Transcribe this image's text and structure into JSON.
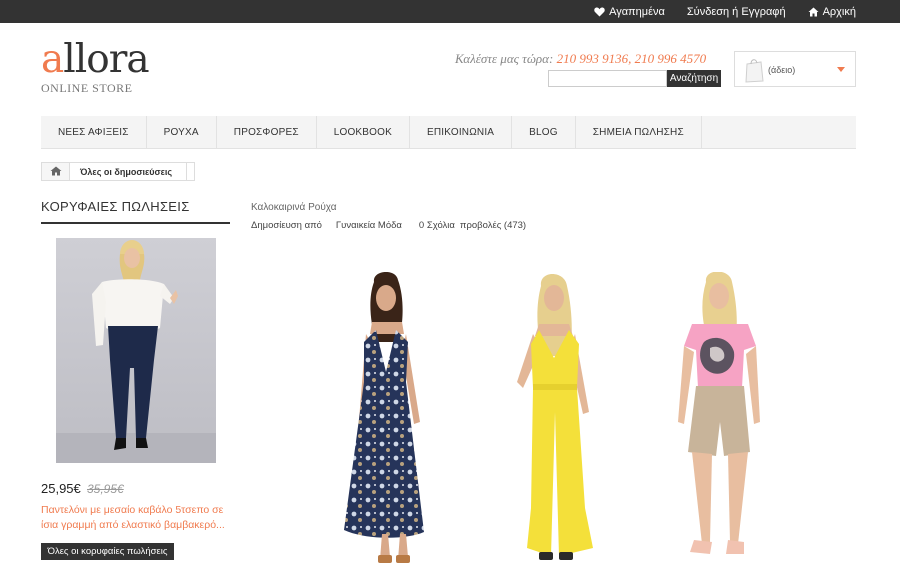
{
  "topbar": {
    "favorites_label": "Αγαπημένα",
    "login_label": "Σύνδεση ή Εγγραφή",
    "home_label": "Αρχική"
  },
  "header": {
    "logo_accent": "a",
    "logo_rest": "llora",
    "logo_sub": "ONLINE STORE",
    "call_prefix": "Καλέστε μας τώρα:",
    "phones": "210 993 9136, 210 996 4570",
    "search_value": "",
    "search_button": "Αναζήτηση",
    "cart_label": "(άδειο)"
  },
  "nav": {
    "items": [
      "ΝΕΕΣ ΑΦΙΞΕΙΣ",
      "ΡΟΥΧΑ",
      "ΠΡΟΣΦΟΡΕΣ",
      "LOOKBOOK",
      "ΕΠΙΚΟΙΝΩΝΙΑ",
      "BLOG",
      "ΣΗΜΕΙΑ ΠΩΛΗΣΗΣ"
    ]
  },
  "breadcrumb": {
    "label": "Όλες οι δημοσιεύσεις"
  },
  "sidebar": {
    "title": "ΚΟΡΥΦΑΙΕΣ ΠΩΛΗΣΕΙΣ",
    "price": "25,95€",
    "old_price": "35,95€",
    "product_name": "Παντελόνι με μεσαίο καβάλο 5τσεπο σε ίσια γραμμή από ελαστικό βαμβακερό...",
    "all_button": "Όλες οι κορυφαίες πωλήσεις"
  },
  "post": {
    "title": "Καλοκαιρινά Ρούχα",
    "published_by": "Δημοσίευση από",
    "category": "Γυναικεία Μόδα",
    "comments": "0 Σχόλια",
    "views": "προβολές (473)"
  },
  "colors": {
    "accent": "#f07b4f",
    "dark": "#333333"
  }
}
